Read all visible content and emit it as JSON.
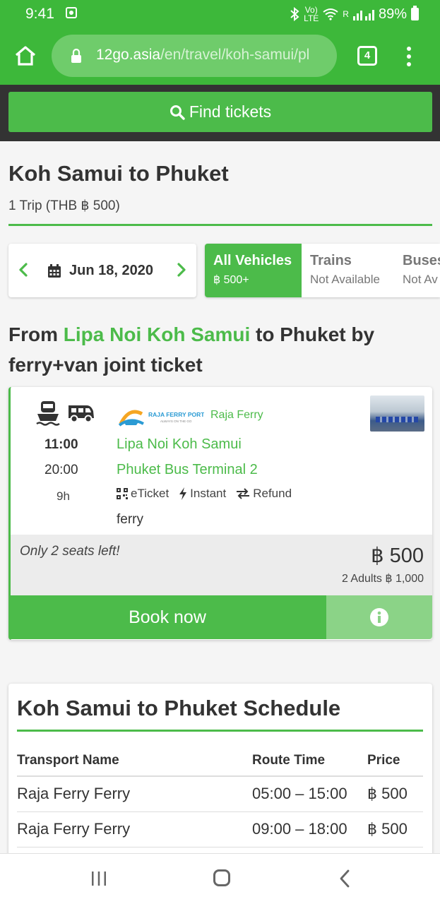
{
  "status_bar": {
    "time": "9:41",
    "network_top": "Vo)",
    "network_bottom": "LTE",
    "signal_label": "R",
    "battery": "89%"
  },
  "browser": {
    "url_domain": "12go.asia",
    "url_path": "/en/travel/koh-samui/pl",
    "tab_count": "4"
  },
  "find_tickets": {
    "label": "Find tickets"
  },
  "header": {
    "title": "Koh Samui to Phuket",
    "trip_count": "1 Trip (THB ฿ 500)"
  },
  "date_picker": {
    "date": "Jun 18, 2020"
  },
  "vehicle_tabs": [
    {
      "label": "All Vehicles",
      "sub": "฿ 500+",
      "active": true
    },
    {
      "label": "Trains",
      "sub": "Not Available",
      "active": false
    },
    {
      "label": "Buses",
      "sub": "Not Av",
      "active": false
    }
  ],
  "route_heading": {
    "prefix": "From ",
    "highlight": "Lipa Noi Koh Samui",
    "suffix": " to Phuket by ferry+van joint ticket"
  },
  "result": {
    "icons": [
      "ferry-icon",
      "van-icon"
    ],
    "departure_time": "11:00",
    "arrival_time": "20:00",
    "duration": "9h",
    "operator_logo_text": "RAJA FERRY PORT",
    "operator_logo_tagline": "ALWAYS ON THE GO",
    "operator_name": "Raja Ferry",
    "from_station": "Lipa Noi Koh Samui",
    "to_station": "Phuket Bus Terminal 2",
    "features": [
      {
        "icon": "qr-code-icon",
        "label": "eTicket"
      },
      {
        "icon": "lightning-icon",
        "label": "Instant"
      },
      {
        "icon": "swap-arrows-icon",
        "label": "Refund"
      }
    ],
    "mode": "ferry",
    "seats_left": "Only 2 seats left!",
    "price": "฿ 500",
    "price_detail": "2 Adults ฿ 1,000",
    "book_label": "Book now"
  },
  "schedule": {
    "title": "Koh Samui to Phuket Schedule",
    "columns": [
      "Transport Name",
      "Route Time",
      "Price"
    ],
    "rows": [
      {
        "name": "Raja Ferry Ferry",
        "time": "05:00 – 15:00",
        "price": "฿ 500"
      },
      {
        "name": "Raja Ferry Ferry",
        "time": "09:00 – 18:00",
        "price": "฿ 500"
      }
    ]
  },
  "colors": {
    "brand_green": "#4cbb4a",
    "status_green": "#3db83a",
    "dark_bar": "#333333",
    "light_green": "#8bd387"
  }
}
